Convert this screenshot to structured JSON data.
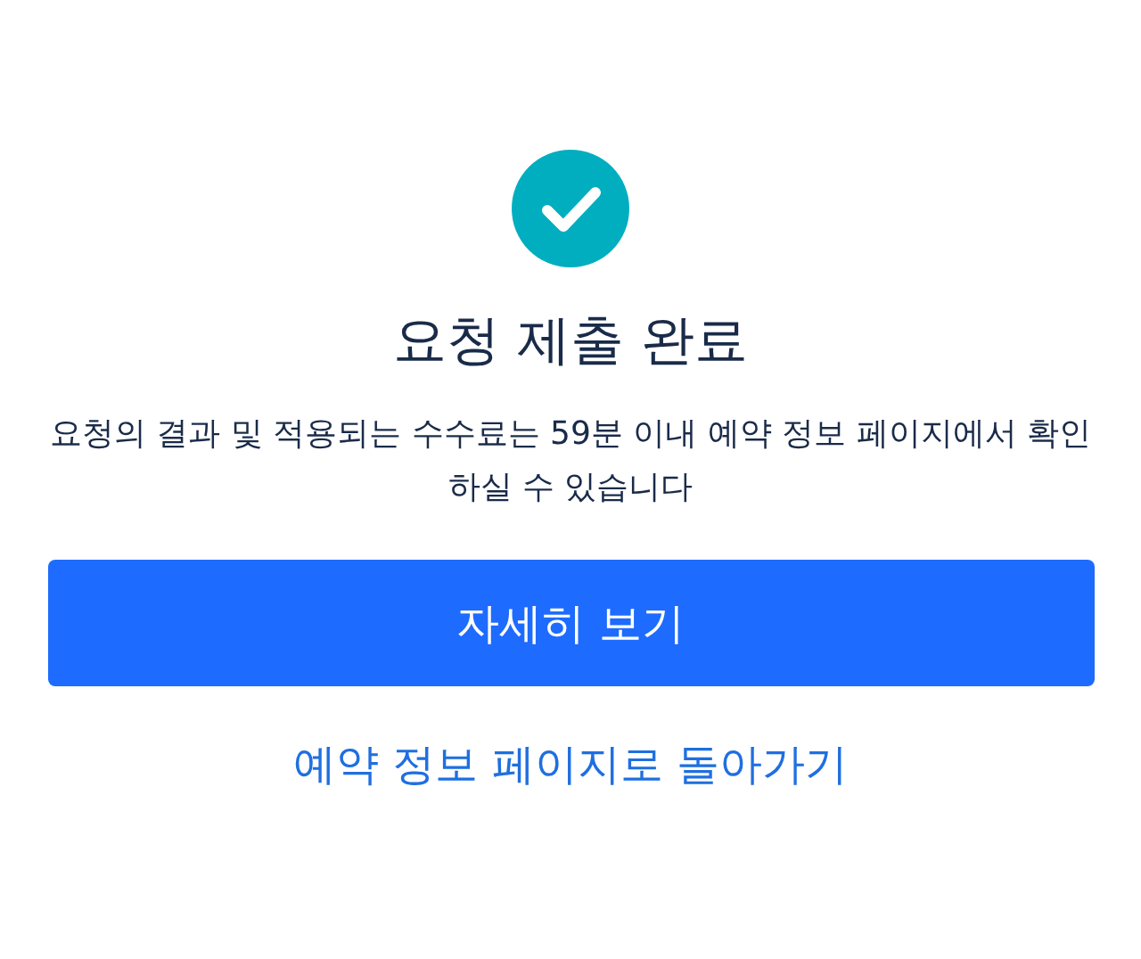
{
  "title": "요청 제출 완료",
  "message": "요청의 결과 및 적용되는 수수료는 59분 이내 예약 정보 페이지에서 확인하실 수 있습니다",
  "primary_button": "자세히 보기",
  "link": "예약 정보 페이지로 돌아가기"
}
